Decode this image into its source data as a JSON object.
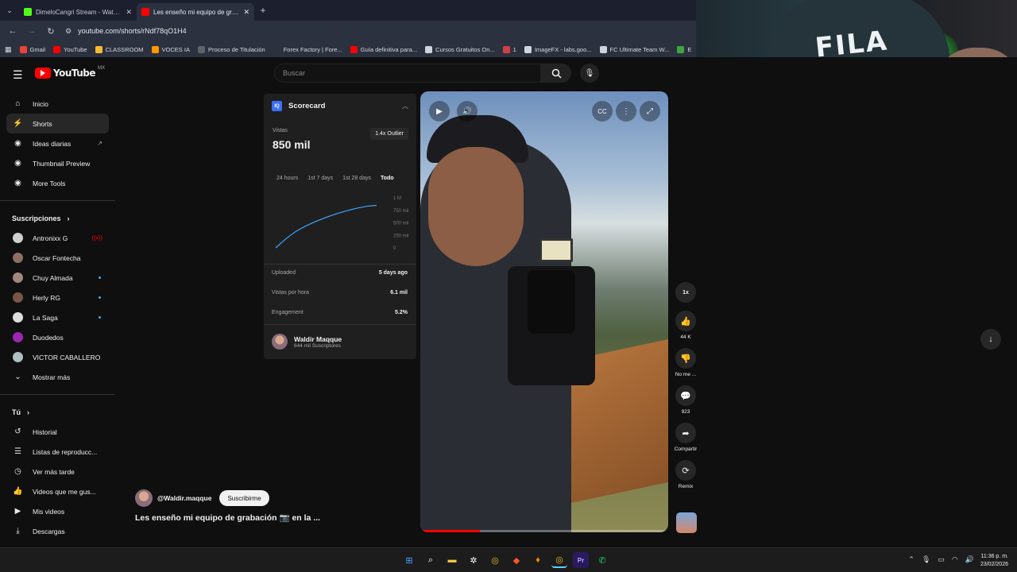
{
  "browser": {
    "tabs": [
      {
        "title": "DimeloCangri Stream - Watch L...",
        "fav_color": "#53fc18",
        "active": false
      },
      {
        "title": "Les enseño mi equipo de grab...",
        "fav_color": "#ff0000",
        "active": true
      }
    ],
    "new_tab": "+",
    "url": "youtube.com/shorts/rNdf78qO1H4",
    "bookmarks": [
      {
        "label": "Gmail",
        "color": "#ea4335"
      },
      {
        "label": "YouTube",
        "color": "#ff0000"
      },
      {
        "label": "CLASSROOM",
        "color": "#f9bb2d"
      },
      {
        "label": "VOCES IA",
        "color": "#ff9800"
      },
      {
        "label": "Proceso de Titulación",
        "color": "#5f6368"
      },
      {
        "label": "Forex Factory | Fore...",
        "color": "#2c3140"
      },
      {
        "label": "Guía definitiva para...",
        "color": "#ff0000"
      },
      {
        "label": "Cursos Gratuitos On...",
        "color": "#cfd3db"
      },
      {
        "label": "1",
        "color": "#d04040"
      },
      {
        "label": "ImageFX - labs.goo...",
        "color": "#cfd3db"
      },
      {
        "label": "FC Ultimate Team W...",
        "color": "#cfd3db"
      },
      {
        "label": "E",
        "color": "#3ea63e"
      }
    ]
  },
  "youtube": {
    "logo_text": "YouTube",
    "region": "MX",
    "search_placeholder": "Buscar"
  },
  "sidebar": {
    "main": [
      {
        "label": "Inicio",
        "icon": "home-icon",
        "glyph": "⌂",
        "active": false
      },
      {
        "label": "Shorts",
        "icon": "shorts-icon",
        "glyph": "⚡",
        "active": true
      },
      {
        "label": "Ideas diarias",
        "icon": "ideas-icon",
        "glyph": "◉",
        "active": false,
        "external": true
      },
      {
        "label": "Thumbnail Preview",
        "icon": "thumbnail-icon",
        "glyph": "◉",
        "active": false
      },
      {
        "label": "More Tools",
        "icon": "tools-icon",
        "glyph": "◉",
        "active": false
      }
    ],
    "subs_header": "Suscripciones",
    "subscriptions": [
      {
        "label": "Antronixx G",
        "color": "#cfcfcf",
        "badge": "live"
      },
      {
        "label": "Oscar Fontecha",
        "color": "#8d6e63",
        "badge": "none"
      },
      {
        "label": "Chuy Almada",
        "color": "#a1887f",
        "badge": "dot"
      },
      {
        "label": "Herly RG",
        "color": "#795548",
        "badge": "dot"
      },
      {
        "label": "La Saga",
        "color": "#dddddd",
        "badge": "dot"
      },
      {
        "label": "Duodedos",
        "color": "#9c27b0",
        "badge": "none"
      },
      {
        "label": "VICTOR CABALLERO",
        "color": "#b0bec5",
        "badge": "none"
      }
    ],
    "show_more": "Mostrar más",
    "you_header": "Tú",
    "you_items": [
      {
        "label": "Historial",
        "icon": "history-icon",
        "glyph": "↺"
      },
      {
        "label": "Listas de reproducc...",
        "icon": "playlists-icon",
        "glyph": "☰"
      },
      {
        "label": "Ver más tarde",
        "icon": "watch-later-icon",
        "glyph": "◷"
      },
      {
        "label": "Videos que me gus...",
        "icon": "liked-icon",
        "glyph": "👍"
      },
      {
        "label": "Mis videos",
        "icon": "my-videos-icon",
        "glyph": "▶"
      },
      {
        "label": "Descargas",
        "icon": "downloads-icon",
        "glyph": "⤓"
      }
    ]
  },
  "scorecard": {
    "title": "Scorecard",
    "views_label": "Vistas",
    "views_value": "850 mil",
    "outlier": "1.4x Outlier",
    "ranges": [
      "24 hours",
      "1st 7 days",
      "1st 28 days",
      "Todo"
    ],
    "active_range": "Todo",
    "rows": [
      {
        "label": "Uploaded",
        "value": "5 days ago"
      },
      {
        "label": "Vistas por hora",
        "value": "6.1 mil"
      },
      {
        "label": "Engagement",
        "value": "5.2%"
      }
    ],
    "creator_name": "Waldir Maqque",
    "creator_subs": "644 mil Suscriptores"
  },
  "chart_data": {
    "type": "line",
    "title": "",
    "y_tick_labels": [
      "1 M",
      "750 mil",
      "500 mil",
      "250 mil",
      "0"
    ],
    "ylim": [
      0,
      1000000
    ],
    "series": [
      {
        "values": [
          0,
          180000,
          330000,
          440000,
          530000,
          610000,
          680000,
          740000,
          790000,
          830000,
          850000
        ]
      }
    ],
    "grid": false
  },
  "short": {
    "channel": "@Waldir.maqque",
    "subscribe": "Suscribirme",
    "title": "Les enseño mi equipo de grabación 📷 en la ...",
    "progress": 0.24
  },
  "actions": [
    {
      "label": "",
      "glyph": "1x",
      "name": "speed-button"
    },
    {
      "label": "44 K",
      "glyph": "👍",
      "name": "like-button"
    },
    {
      "label": "No me ...",
      "glyph": "👎",
      "name": "dislike-button"
    },
    {
      "label": "923",
      "glyph": "💬",
      "name": "comments-button"
    },
    {
      "label": "Compartir",
      "glyph": "➦",
      "name": "share-button"
    },
    {
      "label": "Remix",
      "glyph": "⟳",
      "name": "remix-button"
    }
  ],
  "taskbar": {
    "time": "11:36 p. m.",
    "date": "23/02/2026"
  }
}
